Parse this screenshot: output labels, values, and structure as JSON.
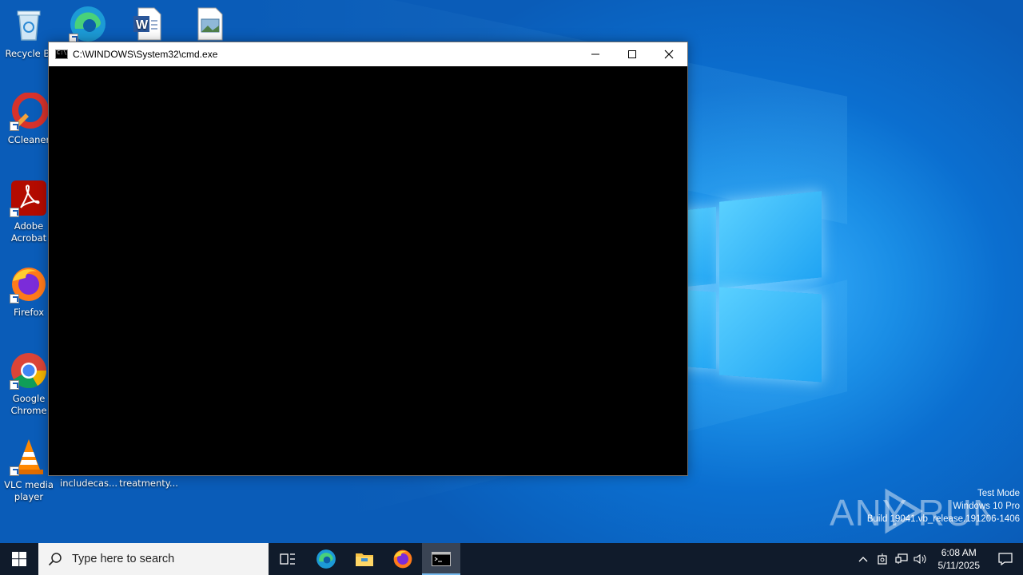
{
  "desktop": {
    "icons": [
      {
        "label": "Recycle Bin",
        "display": "Recycle Bi"
      },
      {
        "label": "Microsoft Edge",
        "display": ""
      },
      {
        "label": "Word document",
        "display": ""
      },
      {
        "label": "Image file",
        "display": ""
      },
      {
        "label": "CCleaner",
        "display": "CCleaner"
      },
      {
        "label": "Adobe Acrobat",
        "display": "Adobe Acrobat"
      },
      {
        "label": "Firefox",
        "display": "Firefox"
      },
      {
        "label": "Google Chrome",
        "display": "Google Chrome"
      },
      {
        "label": "VLC media player",
        "display": "VLC media player"
      },
      {
        "label": "includecas...",
        "display": "includecas..."
      },
      {
        "label": "treatmenty...",
        "display": "treatmenty..."
      }
    ]
  },
  "cmd_window": {
    "title": "C:\\WINDOWS\\System32\\cmd.exe",
    "icon": "console-icon"
  },
  "watermark": {
    "brand": "ANY RUN",
    "line1": "Test Mode",
    "line2": "Windows 10 Pro",
    "line3": "Build 19041.vb_release.191206-1406"
  },
  "taskbar": {
    "search_placeholder": "Type here to search",
    "pinned": [
      "task-view-icon",
      "edge-icon",
      "file-explorer-icon",
      "firefox-icon",
      "cmd-icon"
    ],
    "clock": {
      "time": "6:08 AM",
      "date": "5/11/2025"
    }
  },
  "colors": {
    "accent": "#76b9ed",
    "taskbar": "#101b2b",
    "wallpaper": "#0b6fd0"
  }
}
